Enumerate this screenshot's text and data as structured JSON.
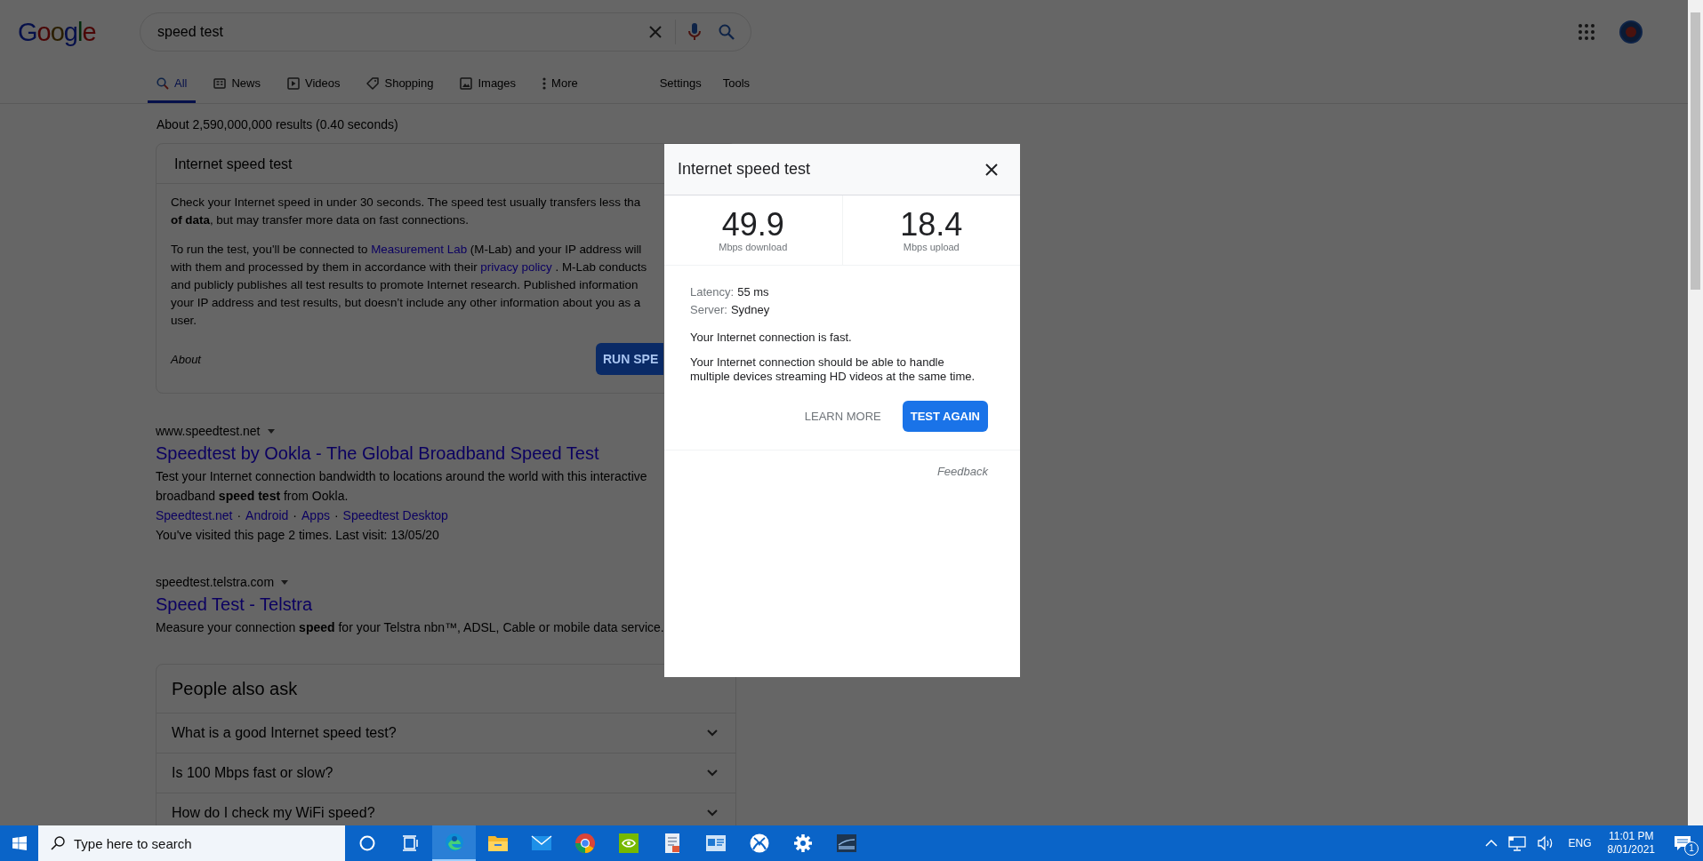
{
  "header": {
    "logo": "Google",
    "search": {
      "value": "speed test"
    },
    "tabs": [
      {
        "label": "All",
        "kind": "search",
        "selected": true
      },
      {
        "label": "News",
        "kind": "news",
        "selected": false
      },
      {
        "label": "Videos",
        "kind": "videos",
        "selected": false
      },
      {
        "label": "Shopping",
        "kind": "shopping",
        "selected": false
      },
      {
        "label": "Images",
        "kind": "images",
        "selected": false
      },
      {
        "label": "More",
        "kind": "more",
        "selected": false
      }
    ],
    "tools": [
      "Settings",
      "Tools"
    ]
  },
  "result_stats": "About 2,590,000,000 results (0.40 seconds)",
  "speed_card": {
    "title": "Internet speed test",
    "paragraphs": [
      [
        [
          {
            "kind": "text",
            "text": "Check your Internet speed in under 30 seconds. The speed test usually transfers less tha"
          }
        ],
        [
          {
            "kind": "text",
            "text": "**of data**, but may transfer more data on fast connections."
          }
        ]
      ],
      [
        [
          {
            "kind": "text",
            "text": "To run the test, you'll be connected to"
          },
          {
            "kind": "link",
            "text": "Measurement Lab"
          },
          {
            "kind": "text",
            "text": "(M-Lab) and your IP address will"
          }
        ],
        [
          {
            "kind": "text",
            "text": "with them and processed by them in accordance with their"
          },
          {
            "kind": "link",
            "text": "privacy policy"
          },
          {
            "kind": "text",
            "text": ". M-Lab conducts"
          }
        ],
        [
          {
            "kind": "text",
            "text": "and publicly publishes all test results to promote Internet research. Published information"
          }
        ],
        [
          {
            "kind": "text",
            "text": "your IP address and test results, but doesn’t include any other information about you as a"
          }
        ],
        [
          {
            "kind": "text",
            "text": "user."
          }
        ]
      ]
    ],
    "about": "About",
    "button": "RUN SPE"
  },
  "results": [
    {
      "url": "www.speedtest.net",
      "title": "Speedtest by Ookla - The Global Broadband Speed Test",
      "snippet": "Test your Internet connection bandwidth to locations around the world with this interactive broadband **speed test** from Ookla.",
      "sitelinks": [
        "Speedtest.net",
        "Android",
        "Apps",
        "Speedtest Desktop"
      ],
      "separator": "·",
      "visited": "You've visited this page 2 times. Last visit: 13/05/20"
    },
    {
      "url": "speedtest.telstra.com",
      "title": "Speed Test - Telstra",
      "snippet": "Measure your connection **speed** for your Telstra nbn™, ADSL, Cable or mobile data service."
    }
  ],
  "people_also_ask": {
    "title": "People also ask",
    "questions": [
      {
        "text": "What is a good Internet speed test?",
        "expanded": false
      },
      {
        "text": "Is 100 Mbps fast or slow?",
        "expanded": false
      },
      {
        "text": "How do I check my WiFi speed?",
        "expanded": false
      }
    ]
  },
  "dialog": {
    "title": "Internet speed test",
    "stats": [
      {
        "value": "49.9",
        "label": "Mbps download"
      },
      {
        "value": "18.4",
        "label": "Mbps upload"
      }
    ],
    "details": [
      {
        "label": "Latency:",
        "value": "55 ms"
      },
      {
        "label": "Server:",
        "value": "Sydney"
      }
    ],
    "verdict": "Your Internet connection is fast.",
    "description": "Your Internet connection should be able to handle multiple devices streaming HD videos at the same time.",
    "learn_more": "LEARN MORE",
    "test_again": "TEST AGAIN",
    "feedback": "Feedback"
  },
  "taskbar": {
    "search_placeholder": "Type here to search",
    "apps": [
      {
        "kind": "cortana",
        "active": false
      },
      {
        "kind": "taskview",
        "active": false
      },
      {
        "kind": "edge",
        "active": true
      },
      {
        "kind": "explorer",
        "active": false
      },
      {
        "kind": "mail",
        "active": false
      },
      {
        "kind": "chrome",
        "active": false
      },
      {
        "kind": "nvidia",
        "active": false
      },
      {
        "kind": "document",
        "active": false
      },
      {
        "kind": "window",
        "active": false
      },
      {
        "kind": "xbox",
        "active": false
      },
      {
        "kind": "settings",
        "active": false
      },
      {
        "kind": "dcs",
        "active": false
      }
    ],
    "language": "ENG",
    "time": "11:01 PM",
    "date": "8/01/2021",
    "notifications": "1"
  }
}
